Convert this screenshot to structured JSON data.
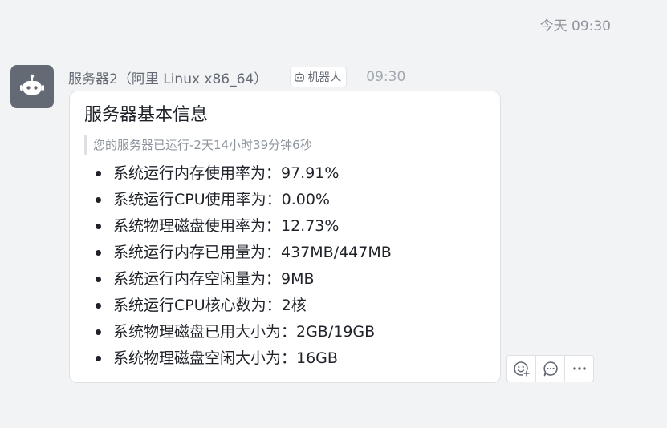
{
  "date_divider": "今天 09:30",
  "sender": {
    "name": "服务器2（阿里 Linux x86_64）",
    "bot_tag": "机器人",
    "time": "09:30",
    "avatar_icon": "robot-icon",
    "avatar_color": "#646a73"
  },
  "card": {
    "title": "服务器基本信息",
    "uptime_note": "您的服务器已运行-2天14小时39分钟6秒",
    "items": [
      "系统运行内存使用率为：97.91%",
      "系统运行CPU使用率为：0.00%",
      "系统物理磁盘使用率为：12.73%",
      "系统运行内存已用量为：437MB/447MB",
      "系统运行内存空闲量为：9MB",
      "系统运行CPU核心数为：2核",
      "系统物理磁盘已用大小为：2GB/19GB",
      "系统物理磁盘空闲大小为：16GB"
    ]
  },
  "actions": {
    "icons": [
      "add-reaction-icon",
      "reply-icon",
      "more-icon"
    ]
  }
}
